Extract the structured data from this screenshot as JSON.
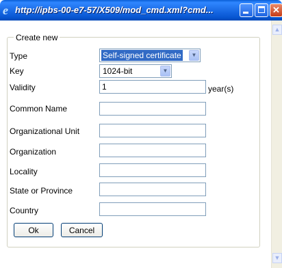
{
  "window": {
    "title": "http://ipbs-00-e7-57/X509/mod_cmd.xml?cmd..."
  },
  "form": {
    "legend": "Create new",
    "type_label": "Type",
    "type_value": "Self-signed certificate",
    "key_label": "Key",
    "key_value": "1024-bit",
    "validity_label": "Validity",
    "validity_value": "1",
    "validity_unit": "year(s)",
    "common_name_label": "Common Name",
    "common_name_value": "",
    "org_unit_label": "Organizational Unit",
    "org_unit_value": "",
    "organization_label": "Organization",
    "organization_value": "",
    "locality_label": "Locality",
    "locality_value": "",
    "state_label": "State or Province",
    "state_value": "",
    "country_label": "Country",
    "country_value": ""
  },
  "buttons": {
    "ok": "Ok",
    "cancel": "Cancel"
  },
  "colors": {
    "titlebar": "#0755d1",
    "close_button": "#c73c17",
    "selection": "#316ac5"
  }
}
